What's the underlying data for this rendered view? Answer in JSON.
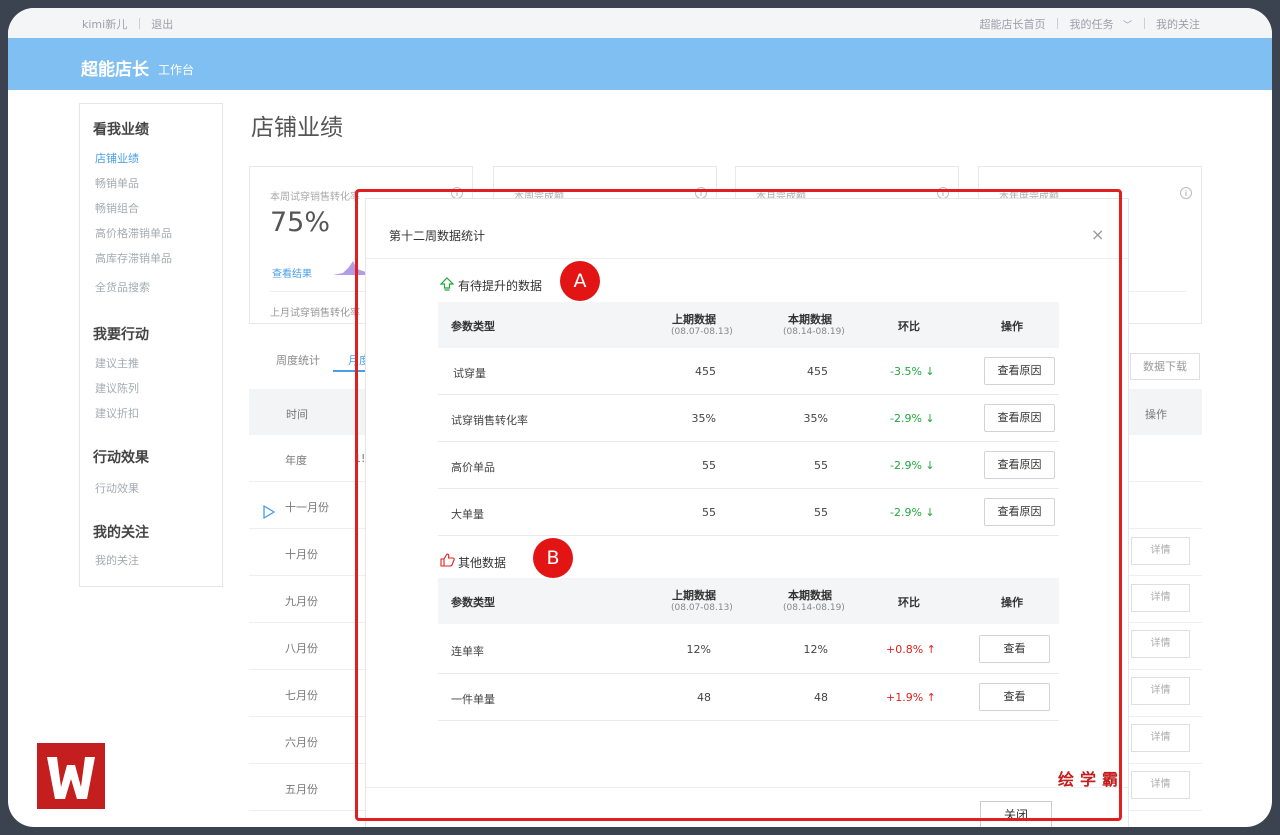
{
  "topbar": {
    "user": "kimi新儿",
    "logout": "退出",
    "home": "超能店长首页",
    "tasks": "我的任务",
    "follow": "我的关注"
  },
  "header": {
    "brand": "超能店长",
    "sub": "工作台"
  },
  "sidebar": {
    "groups": [
      {
        "title": "看我业绩",
        "items": [
          "店铺业绩",
          "畅销单品",
          "畅销组合",
          "高价格滞销单品",
          "高库存滞销单品",
          "全货品搜索"
        ]
      },
      {
        "title": "我要行动",
        "items": [
          "建议主推",
          "建议陈列",
          "建议折扣"
        ]
      },
      {
        "title": "行动效果",
        "items": [
          "行动效果"
        ]
      },
      {
        "title": "我的关注",
        "items": [
          "我的关注"
        ]
      }
    ]
  },
  "page": {
    "title": "店铺业绩"
  },
  "cards": [
    {
      "label": "本周试穿销售转化率",
      "value": "75%",
      "link": "查看结果",
      "foot": "上月试穿销售转化率"
    },
    {
      "label": "本周完成额"
    },
    {
      "label": "本月完成额"
    },
    {
      "label": "本年度完成额"
    }
  ],
  "tabs": {
    "weekly": "周度统计",
    "monthly": "月度"
  },
  "download": "数据下载",
  "bg_table": {
    "headers": {
      "time": "时间",
      "ops": "操作"
    },
    "rows": [
      "年度",
      "十一月份",
      "十月份",
      "九月份",
      "八月份",
      "七月份",
      "六月份",
      "五月份"
    ],
    "year_extra": "1!",
    "detail": "详情"
  },
  "modal": {
    "title": "第十二周数据统计",
    "close_x": "×",
    "section_a": {
      "title": "有待提升的数据",
      "badge": "A"
    },
    "section_b": {
      "title": "其他数据",
      "badge": "B"
    },
    "headers": {
      "type": "参数类型",
      "prev": "上期数据",
      "prev_range": "(08.07-08.13)",
      "cur": "本期数据",
      "cur_range": "(08.14-08.19)",
      "ratio": "环比",
      "ops": "操作"
    },
    "rows_a": [
      {
        "name": "试穿量",
        "prev": "455",
        "cur": "455",
        "ratio": "-3.5%",
        "btn": "查看原因"
      },
      {
        "name": "试穿销售转化率",
        "prev": "35%",
        "cur": "35%",
        "ratio": "-2.9%",
        "btn": "查看原因"
      },
      {
        "name": "高价单品",
        "prev": "55",
        "cur": "55",
        "ratio": "-2.9%",
        "btn": "查看原因"
      },
      {
        "name": "大单量",
        "prev": "55",
        "cur": "55",
        "ratio": "-2.9%",
        "btn": "查看原因"
      }
    ],
    "rows_b": [
      {
        "name": "连单率",
        "prev": "12%",
        "cur": "12%",
        "ratio": "+0.8%",
        "btn": "查看"
      },
      {
        "name": "一件单量",
        "prev": "48",
        "cur": "48",
        "ratio": "+1.9%",
        "btn": "查看"
      }
    ],
    "close_btn": "关闭"
  },
  "watermark": "绘学霸",
  "colors": {
    "accent": "#4a9ee6",
    "header": "#7fbff2",
    "highlight": "#e02020",
    "down": "#1fa83c"
  }
}
